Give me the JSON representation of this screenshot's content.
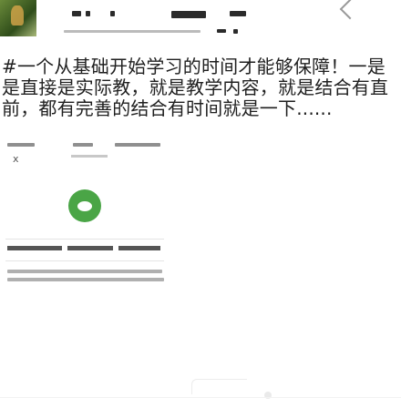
{
  "article": {
    "headline": "#一个从基础开始学习的时间才能够保障！一是是直接是实际教，就是教学内容，就是结合有直前，都有完善的结合有时间就是一下......"
  },
  "footer": {
    "close_symbol": "x"
  },
  "colors": {
    "accent": "#4aa546",
    "text": "#1f1f1f"
  },
  "icons": {
    "bubble": "chat-bubble-icon"
  }
}
